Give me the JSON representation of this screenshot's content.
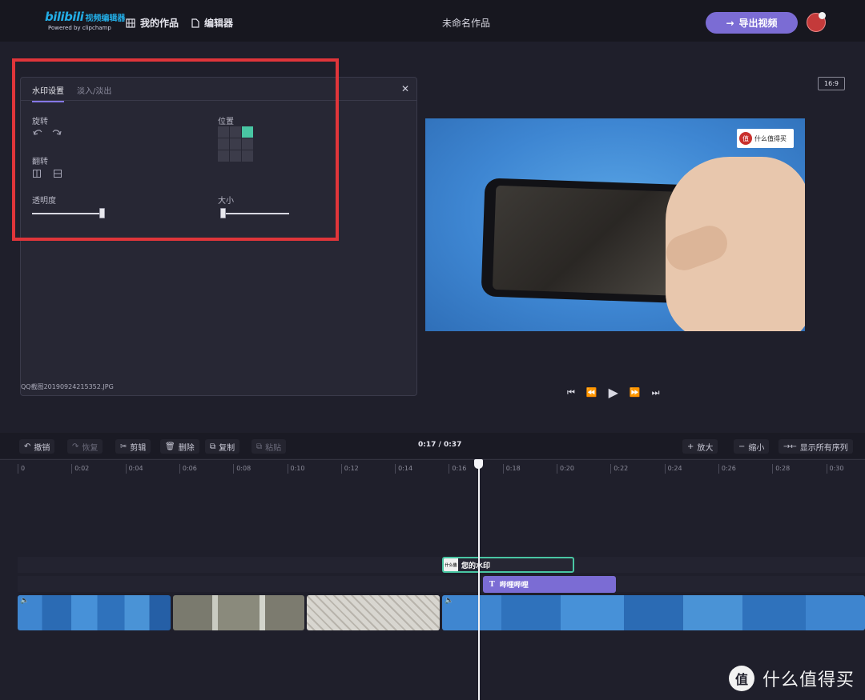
{
  "header": {
    "logo_main": "bilibili",
    "logo_cn": "视频编辑器",
    "logo_sub": "Powered by clipchamp",
    "nav_works": "我的作品",
    "nav_editor": "编辑器",
    "project_title": "未命名作品",
    "export_label": "导出视频"
  },
  "panel": {
    "tab_watermark": "水印设置",
    "tab_fade": "淡入/淡出",
    "rotate_label": "旋转",
    "flip_label": "翻转",
    "position_label": "位置",
    "opacity_label": "透明度",
    "size_label": "大小",
    "filename": "QQ截图20190924215352.JPG",
    "position_selected": "top-right",
    "opacity_value": 1.0,
    "size_value": 0.0
  },
  "preview": {
    "aspect_ratio": "16:9",
    "watermark_text": "什么值得买"
  },
  "toolbar": {
    "undo": "撤销",
    "redo": "恢复",
    "cut": "剪辑",
    "delete": "删除",
    "copy": "复制",
    "paste": "粘贴",
    "timecode": "0:17 / 0:37",
    "zoom_in": "放大",
    "zoom_out": "缩小",
    "show_all": "显示所有序列"
  },
  "ruler": [
    "0",
    "0:02",
    "0:04",
    "0:06",
    "0:08",
    "0:10",
    "0:12",
    "0:14",
    "0:16",
    "0:18",
    "0:20",
    "0:22",
    "0:24",
    "0:26",
    "0:28",
    "0:30"
  ],
  "timeline": {
    "watermark_clip": "您的水印",
    "watermark_thumb": "什么值",
    "text_clip": "哔哩哔哩"
  },
  "brand": {
    "mark": "值",
    "text": "什么值得买"
  },
  "colors": {
    "accent": "#7b6cd4",
    "highlight": "#e0353a",
    "selected": "#49c6a3"
  }
}
